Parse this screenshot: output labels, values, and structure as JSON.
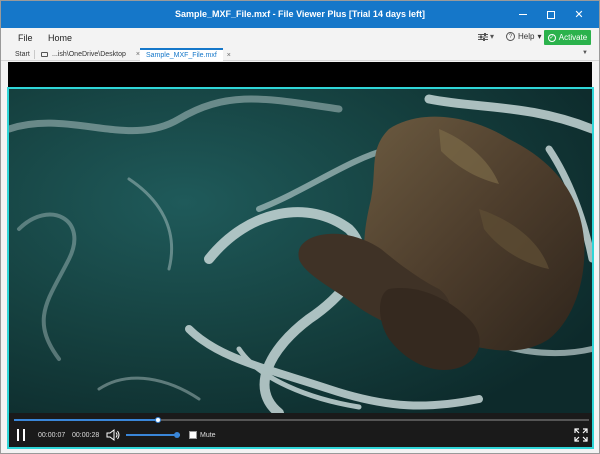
{
  "window": {
    "title": "Sample_MXF_File.mxf - File Viewer Plus [Trial 14 days left]",
    "accent_color": "#1577c9"
  },
  "menu": {
    "file": "File",
    "home": "Home",
    "help": "Help",
    "help_arrow": "▾",
    "settings_arrow": "▾",
    "activate": "Activate",
    "activate_color": "#2bb24c"
  },
  "tabs": {
    "start": "Start",
    "desktop": "...ish\\OneDrive\\Desktop",
    "file": "Sample_MXF_File.mxf",
    "close": "×"
  },
  "player": {
    "current_time": "00:00:07",
    "total_time": "00:00:28",
    "progress_fraction": 0.25,
    "volume_fraction": 1.0,
    "mute_label": "Mute",
    "highlight_color": "#2fd6d8"
  }
}
